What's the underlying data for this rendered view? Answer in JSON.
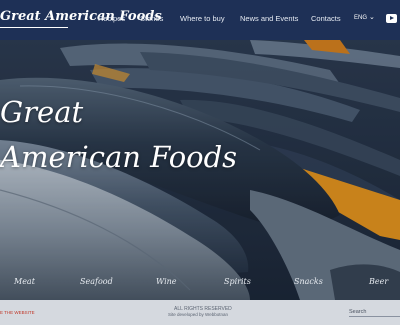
{
  "brand": {
    "logo_text": "Great American Foods"
  },
  "nav": {
    "items": [
      {
        "label": "Recipes"
      },
      {
        "label": "Stories"
      },
      {
        "label": "Where to buy"
      },
      {
        "label": "News and Events"
      },
      {
        "label": "Contacts"
      }
    ],
    "language": "ENG",
    "social_icon": "youtube-icon"
  },
  "hero": {
    "title_line1": "Great",
    "title_line2": "American Foods"
  },
  "categories": [
    {
      "label": "Meat"
    },
    {
      "label": "Seafood"
    },
    {
      "label": "Wine"
    },
    {
      "label": "Spirits"
    },
    {
      "label": "Snacks"
    },
    {
      "label": "Beer"
    }
  ],
  "footer": {
    "left_text": "E THE WEBSITE",
    "rights": "ALL RIGHTS RESERVED",
    "developer": "Site developed by Webbotnan",
    "search_label": "Search"
  },
  "colors": {
    "header_bg": "#1e3056",
    "footer_bg": "#d5d9df",
    "accent_red": "#c0392b",
    "orange_boxes": "#f29a1a"
  }
}
